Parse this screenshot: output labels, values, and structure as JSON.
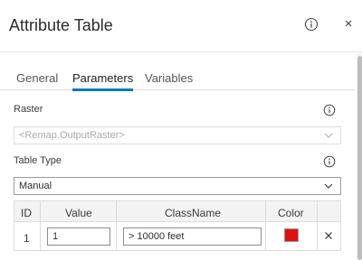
{
  "header": {
    "title": "Attribute Table"
  },
  "tabs": [
    {
      "label": "General",
      "active": false
    },
    {
      "label": "Parameters",
      "active": true
    },
    {
      "label": "Variables",
      "active": false
    }
  ],
  "raster": {
    "label": "Raster",
    "placeholder": "<Remap.OutputRaster>"
  },
  "table_type": {
    "label": "Table Type",
    "value": "Manual"
  },
  "table": {
    "headers": [
      "ID",
      "Value",
      "ClassName",
      "Color"
    ],
    "rows": [
      {
        "id": "1",
        "value": "1",
        "classname": "> 10000 feet",
        "color": "#e01010"
      }
    ]
  },
  "colors": {
    "accent": "#0079c1"
  }
}
